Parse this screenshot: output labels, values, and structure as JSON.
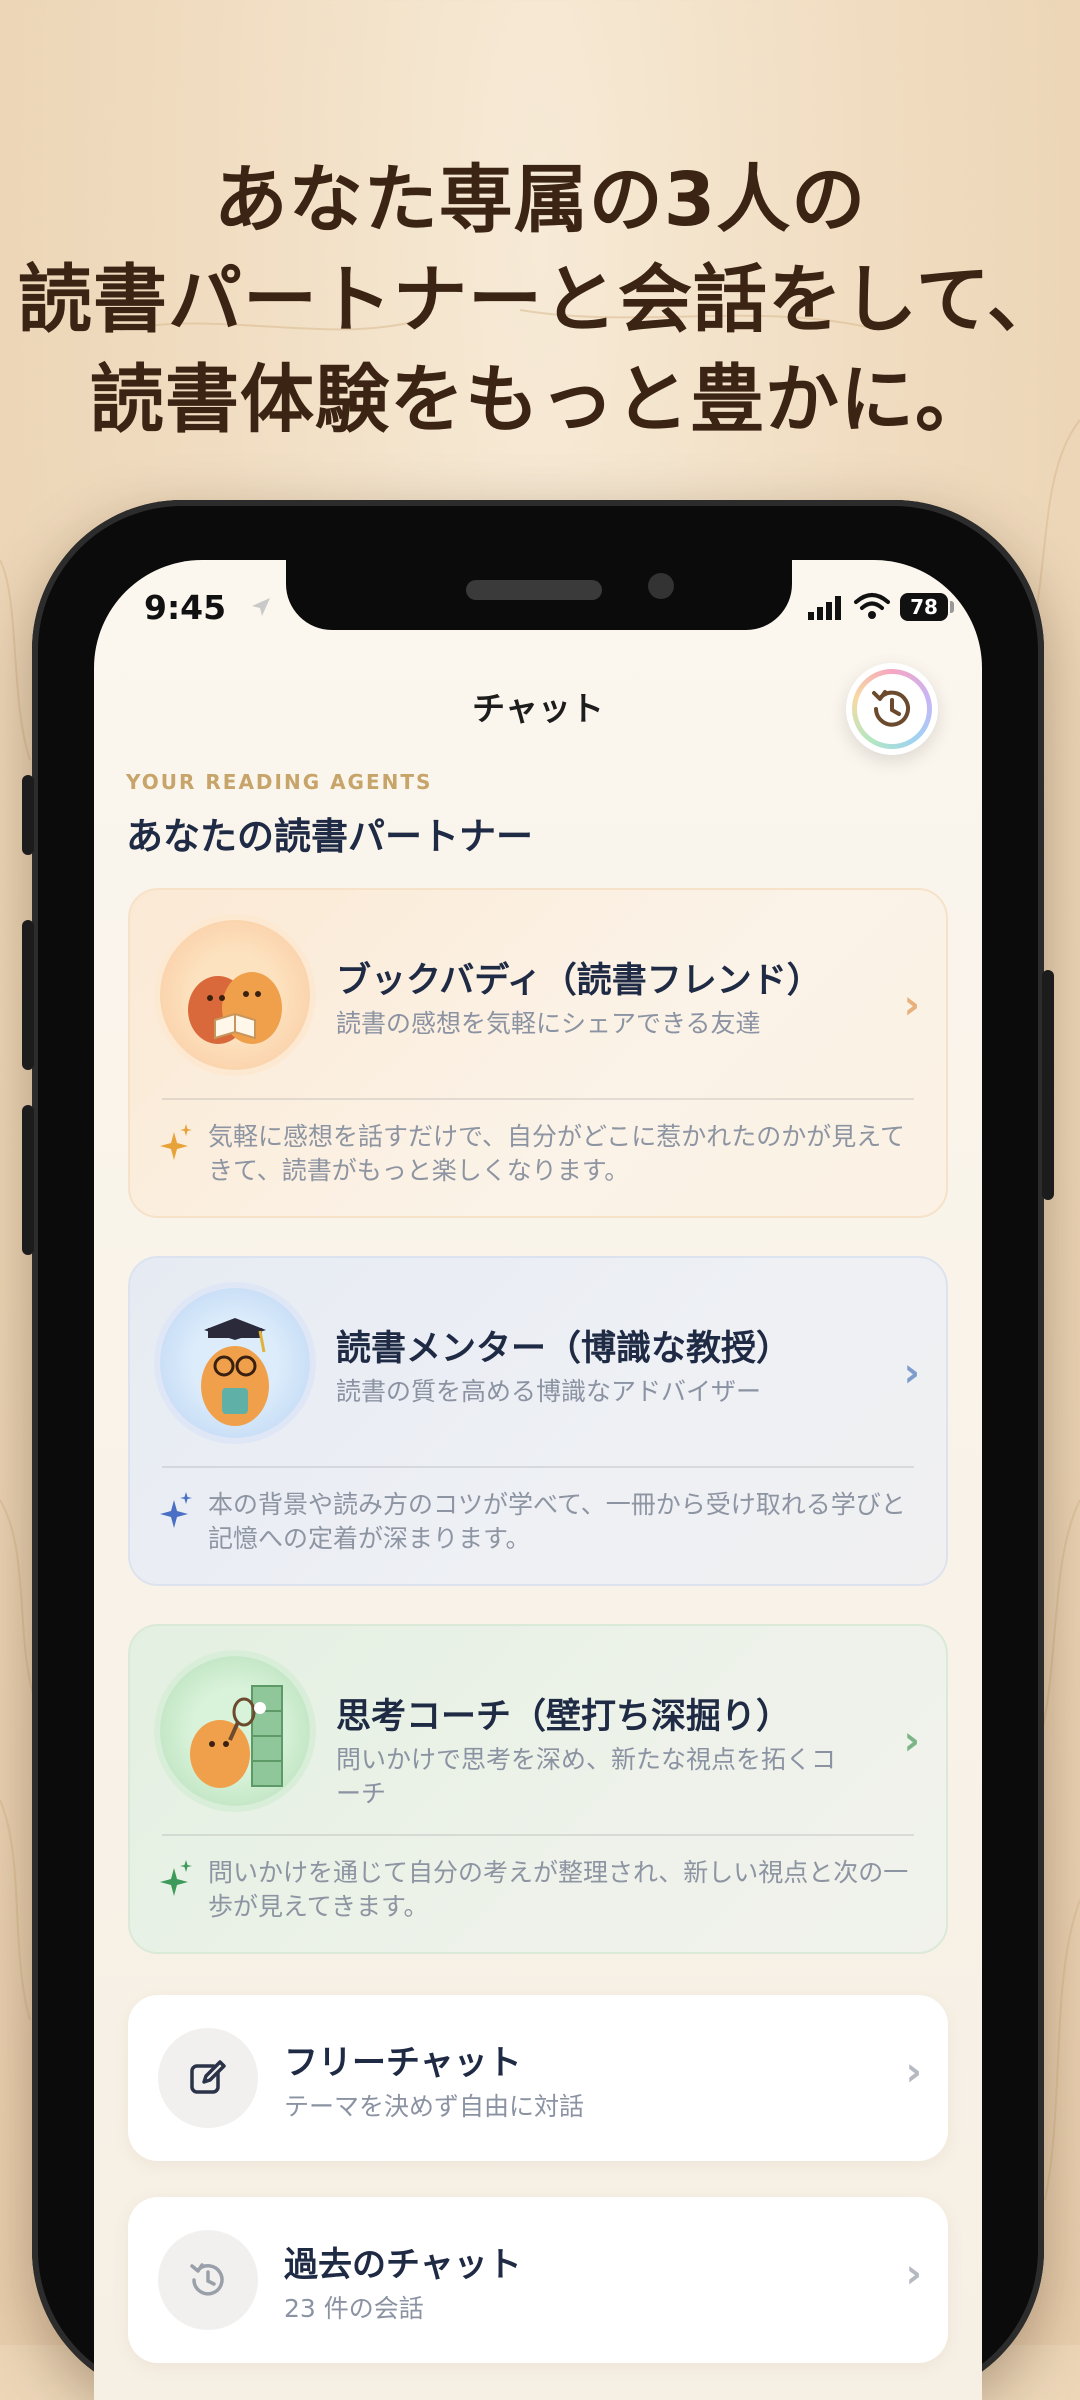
{
  "headline": {
    "line1": "あなた専属の3人の",
    "line2": "読書パートナーと会話をして、",
    "line3": "読書体験をもっと豊かに。"
  },
  "status_bar": {
    "time": "9:45",
    "battery": "78"
  },
  "nav": {
    "title": "チャット",
    "history_icon": "history-icon"
  },
  "section": {
    "eyebrow": "YOUR READING AGENTS",
    "title": "あなたの読書パートナー"
  },
  "agents": [
    {
      "title": "ブックバディ（読書フレンド）",
      "subtitle": "読書の感想を気軽にシェアできる友達",
      "description": "気軽に感想を話すだけで、自分がどこに惹かれたのかが見えてきて、読書がもっと楽しくなります。",
      "accent": "#e8a23a"
    },
    {
      "title": "読書メンター（博識な教授）",
      "subtitle": "読書の質を高める博識なアドバイザー",
      "description": "本の背景や読み方のコツが学べて、一冊から受け取れる学びと記憶への定着が深まります。",
      "accent": "#4a6fc4"
    },
    {
      "title": "思考コーチ（壁打ち深掘り）",
      "subtitle": "問いかけで思考を深め、新たな視点を拓くコーチ",
      "description": "問いかけを通じて自分の考えが整理され、新しい視点と次の一歩が見えてきます。",
      "accent": "#3e9a5a"
    }
  ],
  "free_chat": {
    "title": "フリーチャット",
    "subtitle": "テーマを決めず自由に対話"
  },
  "past_chat": {
    "title": "過去のチャット",
    "subtitle": "23 件の会話"
  },
  "colors": {
    "navy": "#1f2a44",
    "brown": "#3b2414",
    "eyebrow": "#c7a46a"
  }
}
